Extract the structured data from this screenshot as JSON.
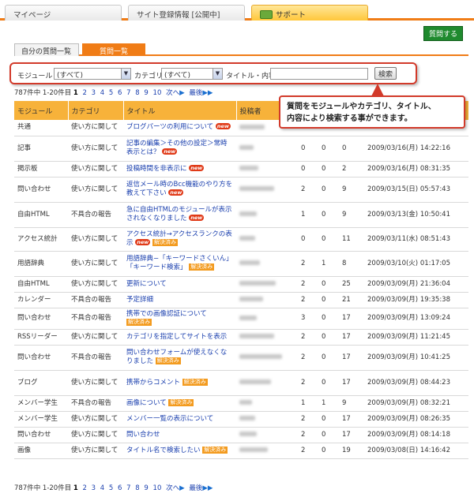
{
  "top_tabs": [
    {
      "label": "マイページ"
    },
    {
      "label": "サイト登録情報 [公開中]"
    },
    {
      "label": "サポート"
    }
  ],
  "ask_button": "質問する",
  "sub_tabs": [
    {
      "label": "自分の質問一覧"
    },
    {
      "label": "質問一覧"
    }
  ],
  "search": {
    "module_label": "モジュール",
    "module_value": "(すべて)",
    "category_label": "カテゴリ",
    "category_value": "(すべて)",
    "keyword_label": "タイトル・内容",
    "keyword_value": "",
    "button": "検索"
  },
  "pager": {
    "summary": "787件中 1-20件目",
    "current": "1",
    "pages": [
      "2",
      "3",
      "4",
      "5",
      "6",
      "7",
      "8",
      "9",
      "10"
    ],
    "next": "次へ",
    "last": "最後"
  },
  "callout": {
    "line1": "質問をモジュールやカテゴリ、タイトル、",
    "line2": "内容により検索する事ができます。"
  },
  "columns": [
    "モジュール",
    "カテゴリ",
    "タイトル",
    "投稿者",
    "",
    "",
    "",
    ""
  ],
  "rows": [
    {
      "module": "共通",
      "category": "使い方に関して",
      "title": "ブログパーツの利用について",
      "new": true,
      "solved": false,
      "a": "",
      "b": "",
      "c": "",
      "date": ""
    },
    {
      "module": "記事",
      "category": "使い方に関して",
      "title": "記事の編集＞その他の設定＞常時表示とは？",
      "new": true,
      "solved": false,
      "a": "0",
      "b": "0",
      "c": "0",
      "date": "2009/03/16(月) 14:22:16"
    },
    {
      "module": "掲示板",
      "category": "使い方に関して",
      "title": "投稿時間を非表示に",
      "new": true,
      "solved": false,
      "a": "0",
      "b": "0",
      "c": "2",
      "date": "2009/03/16(月) 08:31:35"
    },
    {
      "module": "問い合わせ",
      "category": "使い方に関して",
      "title": "返信メール時のBcc機能のやり方を教えて下さい",
      "new": true,
      "solved": false,
      "a": "2",
      "b": "0",
      "c": "9",
      "date": "2009/03/15(日) 05:57:43"
    },
    {
      "module": "自由HTML",
      "category": "不具合の報告",
      "title": "急に自由HTMLのモジュールが表示されなくなりました",
      "new": true,
      "solved": false,
      "a": "1",
      "b": "0",
      "c": "9",
      "date": "2009/03/13(金) 10:50:41"
    },
    {
      "module": "アクセス統計",
      "category": "使い方に関して",
      "title": "アクセス統計→アクセスランクの表示",
      "new": true,
      "solved": true,
      "a": "0",
      "b": "0",
      "c": "11",
      "date": "2009/03/11(水) 08:51:43"
    },
    {
      "module": "用語辞典",
      "category": "使い方に関して",
      "title": "用語辞典−「キーワードさくいん」「キーワード検索」",
      "new": false,
      "solved": true,
      "a": "2",
      "b": "1",
      "c": "8",
      "date": "2009/03/10(火) 01:17:05"
    },
    {
      "module": "自由HTML",
      "category": "使い方に関して",
      "title": "更新について",
      "new": false,
      "solved": false,
      "a": "2",
      "b": "0",
      "c": "25",
      "date": "2009/03/09(月) 21:36:04"
    },
    {
      "module": "カレンダー",
      "category": "不具合の報告",
      "title": "予定詳細",
      "new": false,
      "solved": false,
      "a": "2",
      "b": "0",
      "c": "21",
      "date": "2009/03/09(月) 19:35:38"
    },
    {
      "module": "問い合わせ",
      "category": "不具合の報告",
      "title": "携帯での画像認証について",
      "new": false,
      "solved": true,
      "a": "3",
      "b": "0",
      "c": "17",
      "date": "2009/03/09(月) 13:09:24"
    },
    {
      "module": "RSSリーダー",
      "category": "使い方に関して",
      "title": "カテゴリを指定してサイトを表示",
      "new": false,
      "solved": false,
      "a": "2",
      "b": "0",
      "c": "17",
      "date": "2009/03/09(月) 11:21:45"
    },
    {
      "module": "問い合わせ",
      "category": "不具合の報告",
      "title": "問い合わせフォームが使えなくなりました",
      "new": false,
      "solved": true,
      "a": "2",
      "b": "0",
      "c": "17",
      "date": "2009/03/09(月) 10:41:25"
    },
    {
      "module": "ブログ",
      "category": "使い方に関して",
      "title": "携帯からコメント",
      "new": false,
      "solved": true,
      "a": "2",
      "b": "0",
      "c": "17",
      "date": "2009/03/09(月) 08:44:23"
    },
    {
      "module": "メンバー学生",
      "category": "不具合の報告",
      "title": "画像について",
      "new": false,
      "solved": true,
      "a": "1",
      "b": "1",
      "c": "9",
      "date": "2009/03/09(月) 08:32:21"
    },
    {
      "module": "メンバー学生",
      "category": "使い方に関して",
      "title": "メンバー一覧の表示について",
      "new": false,
      "solved": false,
      "a": "2",
      "b": "0",
      "c": "17",
      "date": "2009/03/09(月) 08:26:35"
    },
    {
      "module": "問い合わせ",
      "category": "使い方に関して",
      "title": "問い合わせ",
      "new": false,
      "solved": false,
      "a": "2",
      "b": "0",
      "c": "17",
      "date": "2009/03/09(月) 08:14:18"
    },
    {
      "module": "画像",
      "category": "使い方に関して",
      "title": "タイトル名で検索したい",
      "new": false,
      "solved": true,
      "a": "2",
      "b": "0",
      "c": "19",
      "date": "2009/03/08(日) 14:16:42"
    }
  ],
  "badges": {
    "new": "new",
    "solved": "解決済み"
  }
}
